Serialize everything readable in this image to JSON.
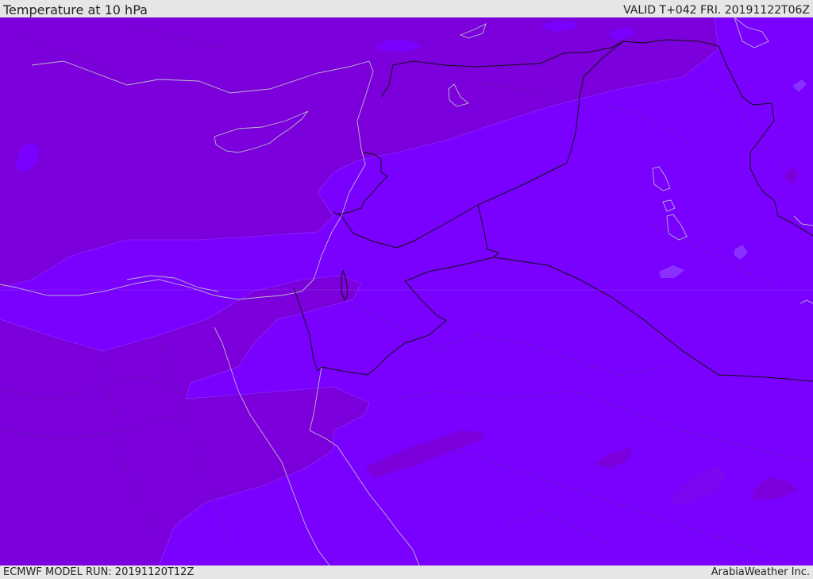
{
  "header": {
    "title": "Temperature at 10 hPa",
    "valid_time": "VALID T+042 FRI. 20191122T06Z"
  },
  "footer": {
    "model_run": "ECMWF MODEL RUN: 20191120T12Z",
    "credit": "ArabiaWeather Inc."
  },
  "map": {
    "colors": {
      "field_warm": "#7a00ff",
      "field_cool": "#7b00dc",
      "field_mid": "#7d05f0",
      "coastline": "#b8b8c8",
      "border": "#111111",
      "admin_border": "#5a2a8a"
    }
  }
}
